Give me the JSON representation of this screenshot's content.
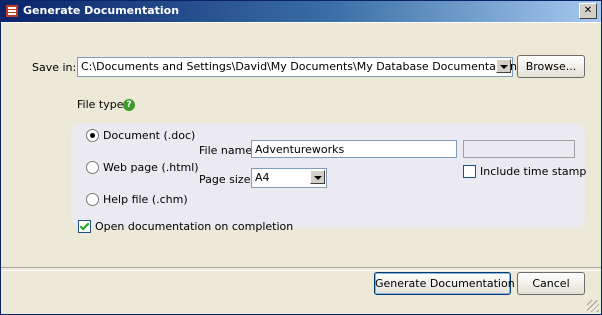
{
  "window": {
    "title": "Generate Documentation",
    "close_label": "✕"
  },
  "save_in": {
    "label": "Save in:",
    "path": "C:\\Documents and Settings\\David\\My Documents\\My Database Documentation",
    "browse_label": "Browse..."
  },
  "file_type": {
    "label": "File type:",
    "options": [
      {
        "label": "Document (.doc)",
        "checked": true
      },
      {
        "label": "Web page (.html)",
        "checked": false
      },
      {
        "label": "Help file (.chm)",
        "checked": false
      }
    ]
  },
  "options_panel": {
    "file_name_label": "File name:",
    "file_name_value": "Adventureworks",
    "page_size_label": "Page size:",
    "page_size_value": "A4",
    "include_timestamp_label": "Include time stamp",
    "include_timestamp_checked": false
  },
  "open_on_completion": {
    "label": "Open documentation on completion",
    "checked": true
  },
  "footer": {
    "generate_label": "Generate Documentation",
    "cancel_label": "Cancel"
  },
  "colors": {
    "title_start": "#0a246a",
    "title_end": "#a6caf0",
    "dialog_bg": "#ece9d8",
    "panel_bg": "#ebeaf0",
    "help_icon": "#3c9a28"
  },
  "icons": [
    "app-icon",
    "close-icon",
    "dropdown-arrow-icon",
    "help-icon",
    "resize-grip-icon"
  ]
}
